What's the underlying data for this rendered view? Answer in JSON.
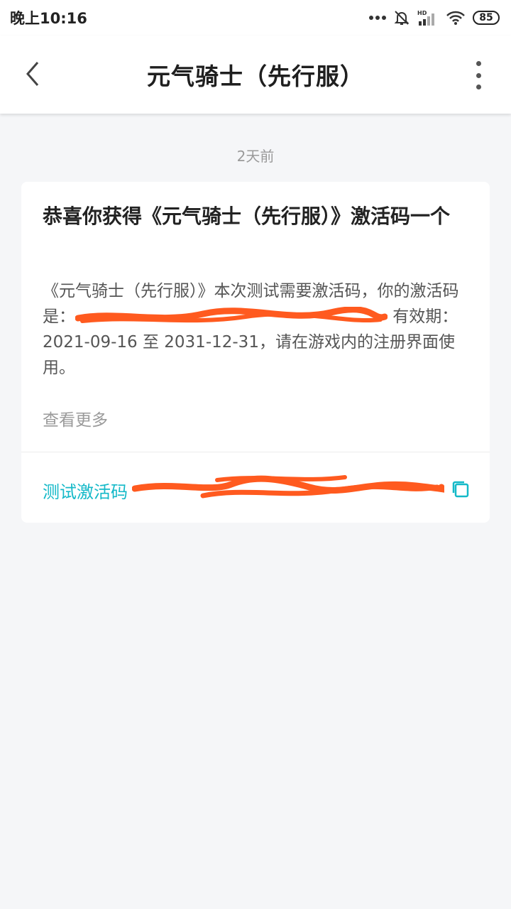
{
  "status_bar": {
    "time": "晚上10:16",
    "battery": "85",
    "icons": [
      "dots-icon",
      "mute-bell-icon",
      "hd-signal-icon",
      "wifi-icon",
      "battery-icon"
    ]
  },
  "nav": {
    "title": "元气骑士（先行服）",
    "back_icon": "chevron-left-icon",
    "more_icon": "more-vertical-icon"
  },
  "message": {
    "time": "2天前",
    "title": "恭喜你获得《元气骑士（先行服）》激活码一个",
    "body_prefix": "《元气骑士（先行服）》本次测试需要激活码，你的激活码是：",
    "body_suffix": " 有效期：2021-09-16 至 2031-12-31，请在游戏内的注册界面使用。",
    "see_more": "查看更多",
    "code_label": "测试激活码",
    "redaction_color": "#ff5a1f"
  },
  "colors": {
    "accent": "#14b9c8",
    "background": "#f5f6f8",
    "card": "#ffffff"
  }
}
